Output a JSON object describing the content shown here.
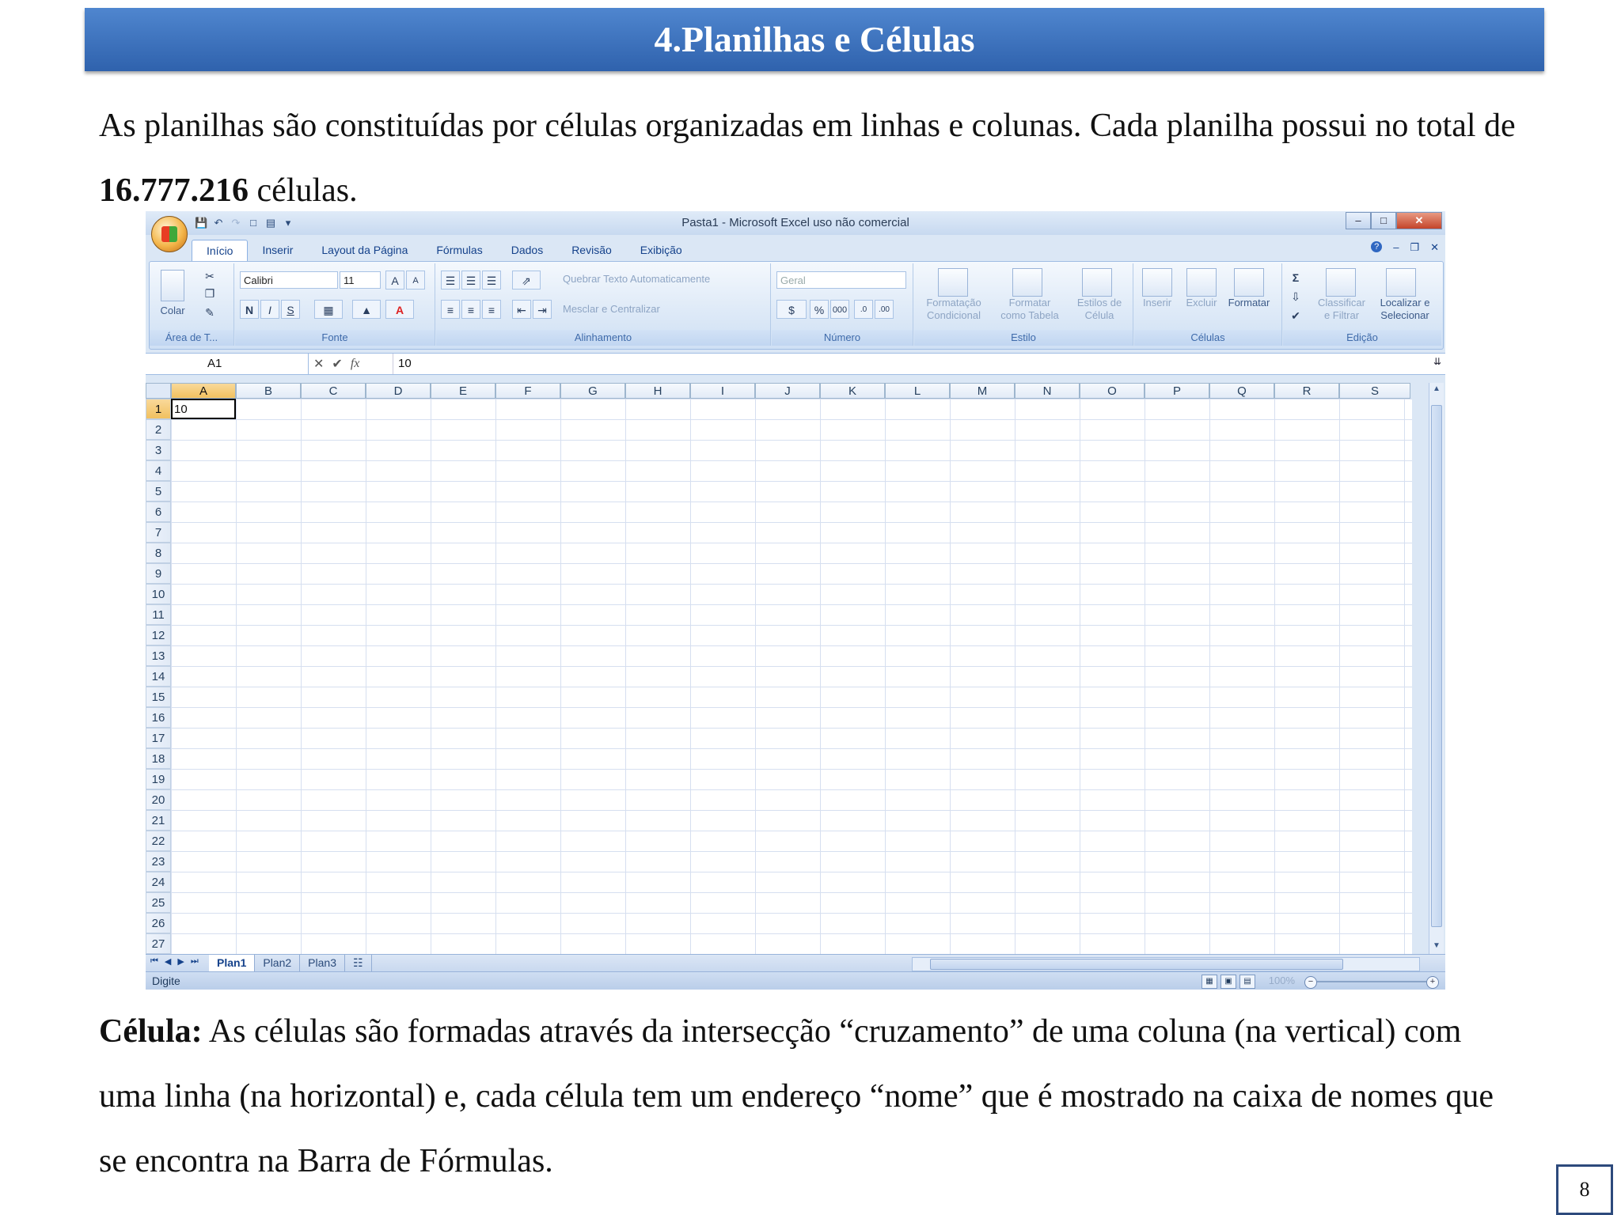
{
  "header": {
    "title": "4.Planilhas e Células"
  },
  "intro": {
    "pre": "As planilhas são constituídas por células organizadas em linhas e colunas. Cada planilha possui no total de ",
    "bold": "16.777.216",
    "post": " células."
  },
  "definition": {
    "term": "Célula:",
    "text": " As células são formadas através da intersecção “cruzamento” de uma coluna (na vertical) com uma linha (na horizontal) e, cada célula tem um endereço “nome” que é mostrado na caixa de nomes que se encontra na Barra de Fórmulas."
  },
  "page_number": "8",
  "excel": {
    "window_title": "Pasta1 - Microsoft Excel uso não comercial",
    "tabs": [
      "Início",
      "Inserir",
      "Layout da Página",
      "Fórmulas",
      "Dados",
      "Revisão",
      "Exibição"
    ],
    "active_tab": "Início",
    "groups": {
      "clipboard": {
        "label": "Área de T...",
        "paste": "Colar"
      },
      "font": {
        "label": "Fonte",
        "font_name": "Calibri",
        "font_size": "11",
        "bold": "N",
        "italic": "I",
        "underline": "S"
      },
      "alignment": {
        "label": "Alinhamento",
        "wrap": "Quebrar Texto Automaticamente",
        "merge": "Mesclar e Centralizar"
      },
      "number": {
        "label": "Número",
        "format": "Geral",
        "percent": "%",
        "thousands": "000"
      },
      "styles": {
        "label": "Estilo",
        "conditional": [
          "Formatação",
          "Condicional"
        ],
        "table": [
          "Formatar",
          "como Tabela"
        ],
        "cell_styles": [
          "Estilos de",
          "Célula"
        ]
      },
      "cells": {
        "label": "Células",
        "insert": "Inserir",
        "delete": "Excluir",
        "format": "Formatar"
      },
      "editing": {
        "label": "Edição",
        "sort": [
          "Classificar",
          "e Filtrar"
        ],
        "find": [
          "Localizar e",
          "Selecionar"
        ]
      }
    },
    "name_box": "A1",
    "formula_value": "10",
    "columns": [
      "A",
      "B",
      "C",
      "D",
      "E",
      "F",
      "G",
      "H",
      "I",
      "J",
      "K",
      "L",
      "M",
      "N",
      "O",
      "P",
      "Q",
      "R",
      "S"
    ],
    "rows": [
      "1",
      "2",
      "3",
      "4",
      "5",
      "6",
      "7",
      "8",
      "9",
      "10",
      "11",
      "12",
      "13",
      "14",
      "15",
      "16",
      "17",
      "18",
      "19",
      "20",
      "21",
      "22",
      "23",
      "24",
      "25",
      "26",
      "27"
    ],
    "cell_a1": "10",
    "sheet_tabs": [
      "Plan1",
      "Plan2",
      "Plan3"
    ],
    "active_sheet": "Plan1",
    "status": "Digite",
    "zoom": "100%"
  }
}
